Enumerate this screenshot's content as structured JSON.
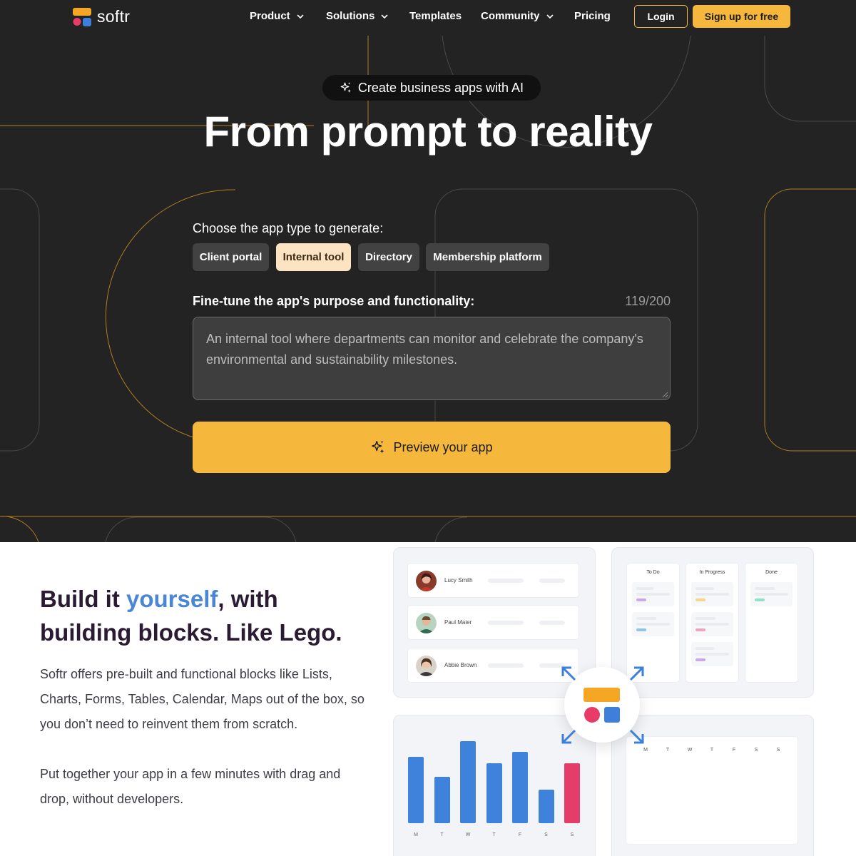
{
  "brand": {
    "name": "softr",
    "accent": "#f5b83d",
    "dark_bg": "#232323"
  },
  "nav": {
    "items": [
      {
        "label": "Product",
        "dropdown": true
      },
      {
        "label": "Solutions",
        "dropdown": true
      },
      {
        "label": "Templates",
        "dropdown": false
      },
      {
        "label": "Community",
        "dropdown": true
      },
      {
        "label": "Pricing",
        "dropdown": false
      }
    ],
    "login": "Login",
    "signup": "Sign up for free"
  },
  "hero": {
    "badge": "Create business apps with AI",
    "title": "From prompt to reality",
    "choose_label": "Choose the app type to generate:",
    "app_types": [
      {
        "label": "Client portal",
        "selected": false
      },
      {
        "label": "Internal tool",
        "selected": true
      },
      {
        "label": "Directory",
        "selected": false
      },
      {
        "label": "Membership platform",
        "selected": false
      }
    ],
    "finetune_label": "Fine-tune the app's purpose and functionality:",
    "char_count": "119/200",
    "prompt_value": "An internal tool where departments can monitor and celebrate the company's environmental and sustainability milestones.",
    "preview_button": "Preview your app"
  },
  "feature": {
    "title_part1": "Build it ",
    "title_highlight": "yourself",
    "title_part2": ", with building blocks. Like Lego.",
    "paragraph1": "Softr offers pre-built and functional blocks like Lists, Charts, Forms, Tables, Calendar, Maps out of the box, so you don’t need to reinvent them from scratch.",
    "paragraph2": "Put together your app in a few minutes with drag and drop, without developers.",
    "list_people": [
      "Lucy Smith",
      "Paul Maier",
      "Abbie Brown"
    ],
    "kanban_columns": [
      "To Do",
      "In Progress",
      "Done"
    ],
    "calendar_days": [
      "M",
      "T",
      "W",
      "T",
      "F",
      "S",
      "S"
    ]
  },
  "chart_data": {
    "type": "bar",
    "categories": [
      "M",
      "T",
      "W",
      "T",
      "F",
      "S",
      "S"
    ],
    "values": [
      93,
      65,
      115,
      84,
      100,
      47,
      84
    ],
    "colors": [
      "#3f82dc",
      "#3f82dc",
      "#3f82dc",
      "#3f82dc",
      "#3f82dc",
      "#3f82dc",
      "#e53d6a"
    ],
    "title": "",
    "xlabel": "",
    "ylabel": "",
    "ylim": [
      0,
      115
    ],
    "grid": false
  }
}
